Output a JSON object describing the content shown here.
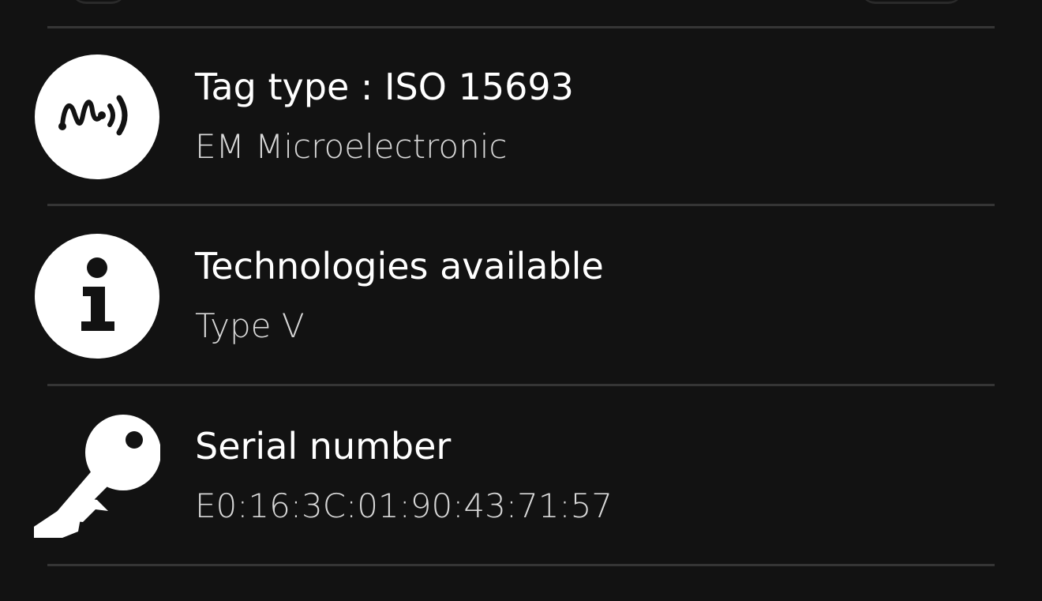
{
  "rows": [
    {
      "title": "Tag type : ISO 15693",
      "subtitle": "EM Microelectronic",
      "icon": "nfc-signal-icon"
    },
    {
      "title": "Technologies available",
      "subtitle": "Type V",
      "icon": "info-icon"
    },
    {
      "title": "Serial number",
      "subtitle": "E0:16:3C:01:90:43:71:57",
      "icon": "key-icon"
    }
  ],
  "colors": {
    "background": "#121212",
    "divider": "#353535",
    "title": "#ffffff",
    "subtitle": "#d7d7d7",
    "icon": "#ffffff"
  }
}
